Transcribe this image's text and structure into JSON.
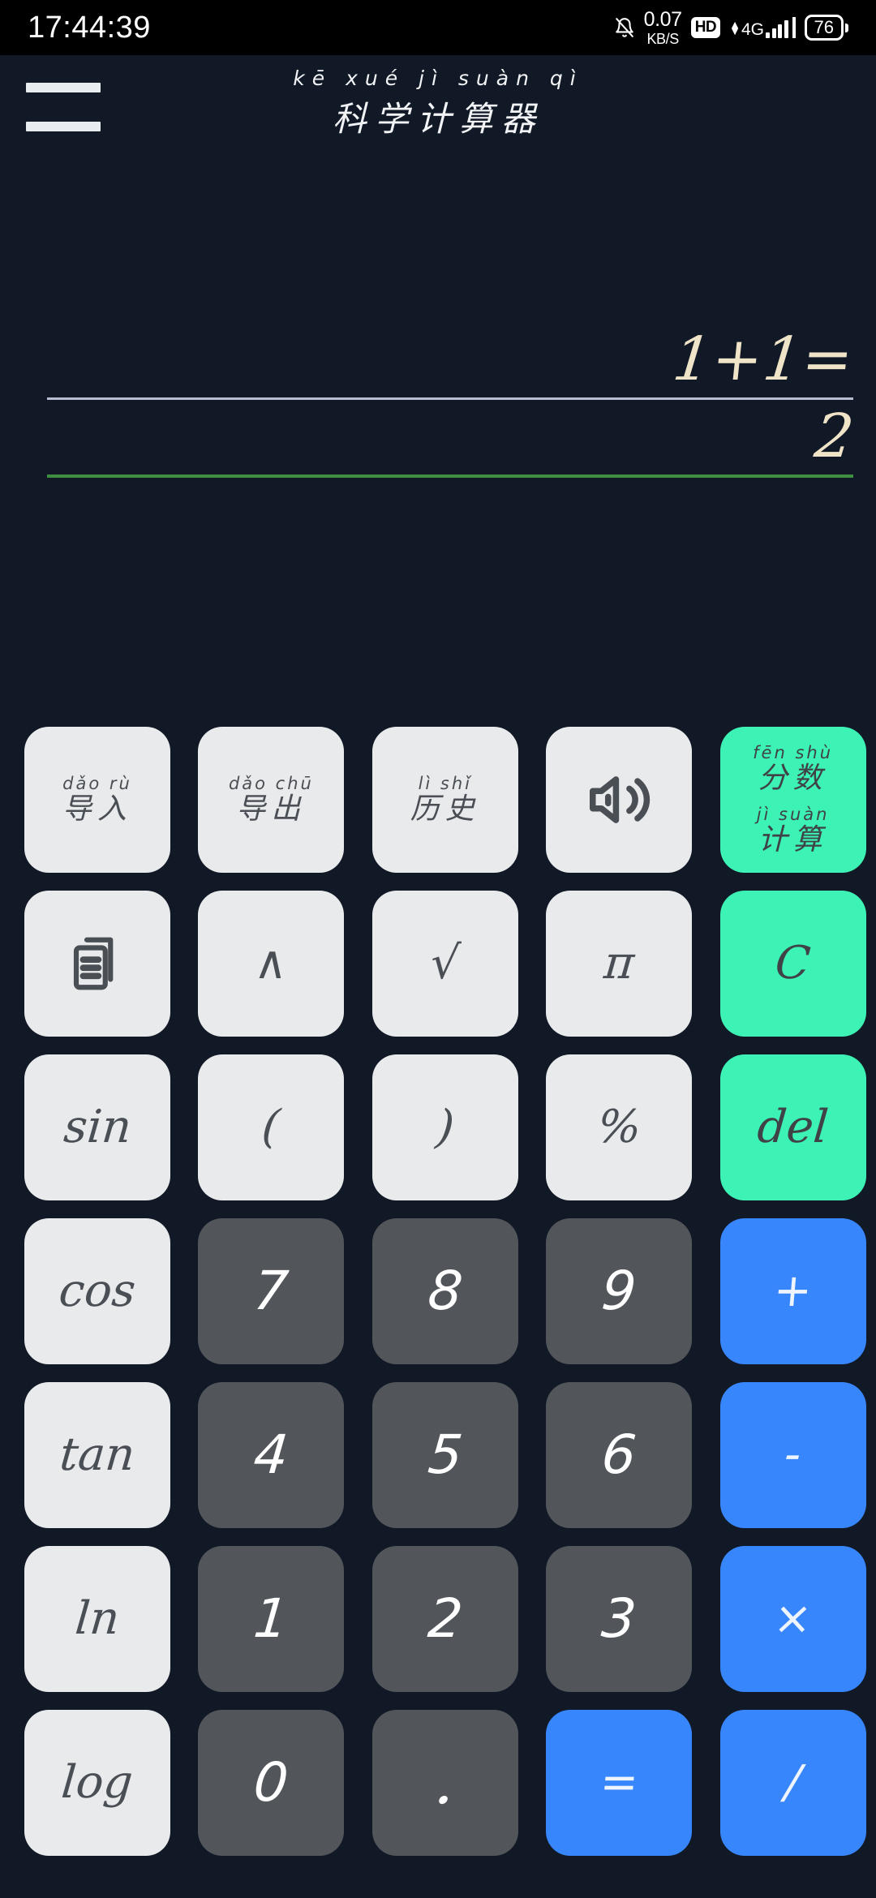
{
  "statusbar": {
    "time": "17:44:39",
    "notification_icon": "bell-muted-icon",
    "net_speed_value": "0.07",
    "net_speed_unit": "KB/S",
    "hd_badge": "HD",
    "network_type": "4G",
    "signal_bars": 4,
    "battery_level": "76"
  },
  "appbar": {
    "menu_icon": "hamburger-menu-icon",
    "title_pinyin": "kē xué jì suàn qì",
    "title_hanzi": "科学计算器"
  },
  "display": {
    "expression": "1+1=",
    "result": "2",
    "expression_rule_color": "#b9bdd1",
    "result_rule_color": "#3f8f42",
    "text_color": "#efe3c8"
  },
  "colors": {
    "background": "#111826",
    "key_light": "#e9eaec",
    "key_dark": "#52565b",
    "key_green": "#3df2b5",
    "key_blue": "#3886fc"
  },
  "keypad": {
    "rows": [
      [
        {
          "name": "import",
          "kind": "cn",
          "style": "light",
          "groups": [
            {
              "pinyin": "dǎo rù",
              "hanzi": "导入"
            }
          ]
        },
        {
          "name": "export",
          "kind": "cn",
          "style": "light",
          "groups": [
            {
              "pinyin": "dǎo chū",
              "hanzi": "导出"
            }
          ]
        },
        {
          "name": "history",
          "kind": "cn",
          "style": "light",
          "groups": [
            {
              "pinyin": "lì shǐ",
              "hanzi": "历史"
            }
          ]
        },
        {
          "name": "sound",
          "kind": "icon",
          "style": "light",
          "icon": "speaker-volume-icon"
        },
        {
          "name": "fraction-calc",
          "kind": "cn",
          "style": "green",
          "groups": [
            {
              "pinyin": "fēn shù",
              "hanzi": "分数"
            },
            {
              "pinyin": "jì suàn",
              "hanzi": "计算"
            }
          ]
        }
      ],
      [
        {
          "name": "copy",
          "kind": "icon",
          "style": "light",
          "icon": "copy-document-icon"
        },
        {
          "name": "power",
          "kind": "glyph",
          "style": "light",
          "label": "∧"
        },
        {
          "name": "sqrt",
          "kind": "glyph",
          "style": "light",
          "label": "√"
        },
        {
          "name": "pi",
          "kind": "glyph",
          "style": "light",
          "label": "π"
        },
        {
          "name": "clear",
          "kind": "glyph",
          "style": "green",
          "label": "C"
        }
      ],
      [
        {
          "name": "sin",
          "kind": "glyph",
          "style": "light",
          "label": "sin"
        },
        {
          "name": "paren-open",
          "kind": "glyph",
          "style": "light",
          "label": "("
        },
        {
          "name": "paren-close",
          "kind": "glyph",
          "style": "light",
          "label": ")"
        },
        {
          "name": "percent",
          "kind": "glyph",
          "style": "light",
          "label": "%"
        },
        {
          "name": "delete",
          "kind": "glyph",
          "style": "green",
          "label": "del"
        }
      ],
      [
        {
          "name": "cos",
          "kind": "glyph",
          "style": "light",
          "label": "cos"
        },
        {
          "name": "digit-7",
          "kind": "num",
          "style": "dark",
          "label": "7"
        },
        {
          "name": "digit-8",
          "kind": "num",
          "style": "dark",
          "label": "8"
        },
        {
          "name": "digit-9",
          "kind": "num",
          "style": "dark",
          "label": "9"
        },
        {
          "name": "plus",
          "kind": "op",
          "style": "blue",
          "label": "+"
        }
      ],
      [
        {
          "name": "tan",
          "kind": "glyph",
          "style": "light",
          "label": "tan"
        },
        {
          "name": "digit-4",
          "kind": "num",
          "style": "dark",
          "label": "4"
        },
        {
          "name": "digit-5",
          "kind": "num",
          "style": "dark",
          "label": "5"
        },
        {
          "name": "digit-6",
          "kind": "num",
          "style": "dark",
          "label": "6"
        },
        {
          "name": "minus",
          "kind": "op",
          "style": "blue",
          "label": "-"
        }
      ],
      [
        {
          "name": "ln",
          "kind": "glyph",
          "style": "light",
          "label": "ln"
        },
        {
          "name": "digit-1",
          "kind": "num",
          "style": "dark",
          "label": "1"
        },
        {
          "name": "digit-2",
          "kind": "num",
          "style": "dark",
          "label": "2"
        },
        {
          "name": "digit-3",
          "kind": "num",
          "style": "dark",
          "label": "3"
        },
        {
          "name": "multiply",
          "kind": "op",
          "style": "blue",
          "label": "×"
        }
      ],
      [
        {
          "name": "log",
          "kind": "glyph",
          "style": "light",
          "label": "log"
        },
        {
          "name": "digit-0",
          "kind": "num",
          "style": "dark",
          "label": "0"
        },
        {
          "name": "decimal-point",
          "kind": "dot",
          "style": "dark",
          "label": "."
        },
        {
          "name": "equals",
          "kind": "op",
          "style": "blue",
          "label": "="
        },
        {
          "name": "divide",
          "kind": "op",
          "style": "blue",
          "label": "/"
        }
      ]
    ]
  }
}
